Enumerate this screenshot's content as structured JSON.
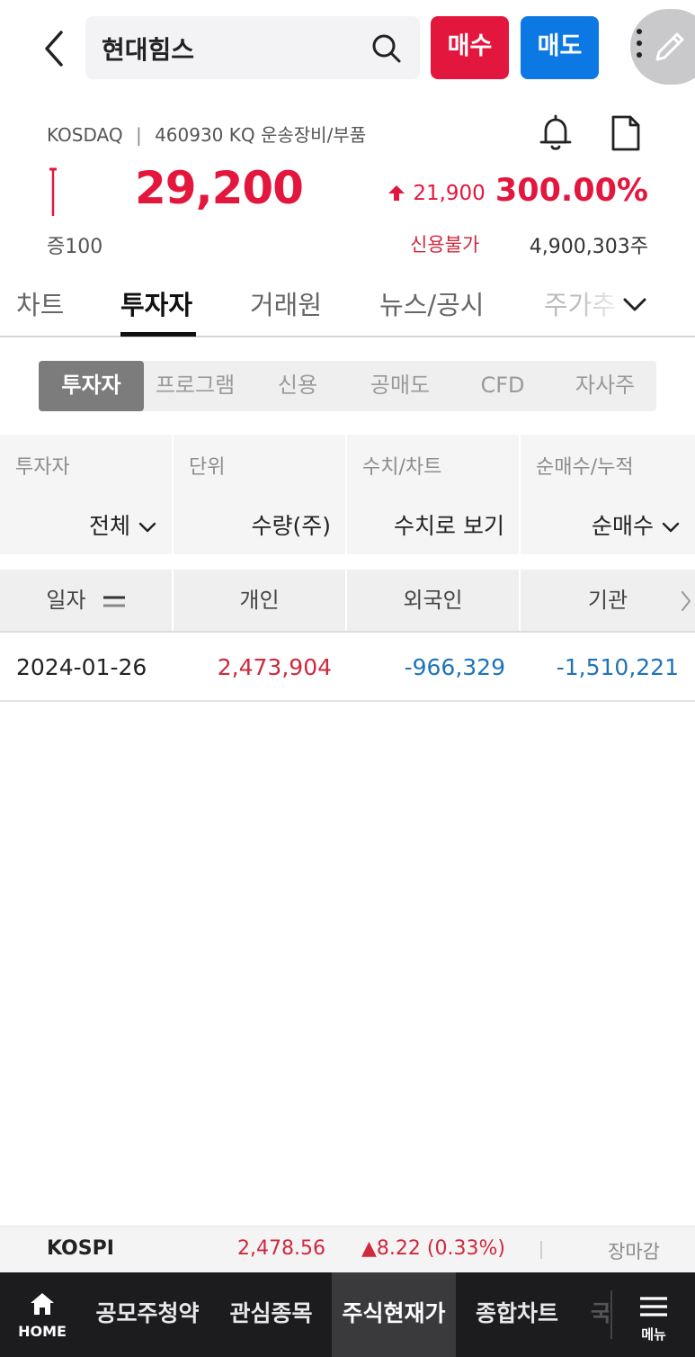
{
  "header": {
    "search_query": "현대힘스",
    "buy_label": "매수",
    "sell_label": "매도"
  },
  "stock": {
    "market": "KOSDAQ",
    "code_info": "460930 KQ 운송장비/부품",
    "price": "29,200",
    "change": "21,900",
    "change_rate": "300.00%",
    "margin_rate": "증100",
    "credit_status": "신용불가",
    "volume": "4,900,303주"
  },
  "main_tabs": [
    {
      "label": "차트"
    },
    {
      "label": "투자자"
    },
    {
      "label": "거래원"
    },
    {
      "label": "뉴스/공시"
    },
    {
      "label": "주가추"
    }
  ],
  "sub_tabs": [
    {
      "label": "투자자"
    },
    {
      "label": "프로그램"
    },
    {
      "label": "신용"
    },
    {
      "label": "공매도"
    },
    {
      "label": "CFD"
    },
    {
      "label": "자사주"
    }
  ],
  "filters": [
    {
      "label": "투자자",
      "value": "전체"
    },
    {
      "label": "단위",
      "value": "수량(주)"
    },
    {
      "label": "수치/차트",
      "value": "수치로 보기"
    },
    {
      "label": "순매수/누적",
      "value": "순매수"
    }
  ],
  "table": {
    "headers": [
      "일자",
      "개인",
      "외국인",
      "기관"
    ],
    "rows": [
      {
        "date": "2024-01-26",
        "individual": "2,473,904",
        "foreign": "-966,329",
        "institution": "-1,510,221"
      }
    ]
  },
  "ticker": {
    "index_name": "KOSPI",
    "index_value": "2,478.56",
    "index_change": "▲8.22 (0.33%)",
    "market_status": "장마감"
  },
  "bottom_nav": {
    "home_label": "HOME",
    "items": [
      {
        "label": "공모주청약"
      },
      {
        "label": "관심종목"
      },
      {
        "label": "주식현재가"
      },
      {
        "label": "종합차트"
      },
      {
        "label": "국"
      }
    ],
    "menu_label": "메뉴"
  },
  "colors": {
    "up": "#e3173e",
    "down": "#1f73b7",
    "buy": "#e3173e",
    "sell": "#0c78e3",
    "nav_bg": "#1c1c1e"
  }
}
